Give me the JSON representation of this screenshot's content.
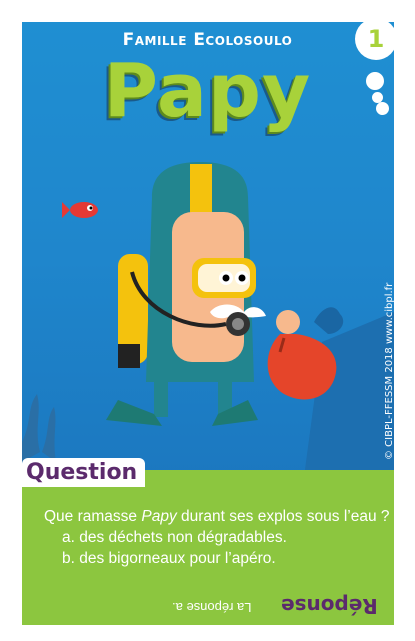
{
  "card": {
    "number": "1",
    "family": "Famille Ecolosoulo",
    "title": "Papy",
    "credit": "© CIBPL-FFESSM 2018 www.cibpl.fr"
  },
  "question": {
    "label": "Question",
    "prefix": "Que ramasse ",
    "name": "Papy",
    "suffix": " durant ses explos sous l’eau ?",
    "options": [
      "a. des déchets non dégradables.",
      "b. des bigorneaux pour l’apéro."
    ]
  },
  "answer": {
    "label": "Réponse",
    "text": "La réponse a."
  },
  "colors": {
    "sky": "#1f8fd2",
    "green": "#8cc63f",
    "purple": "#5b2a6c",
    "title_green": "#a8d23a"
  }
}
